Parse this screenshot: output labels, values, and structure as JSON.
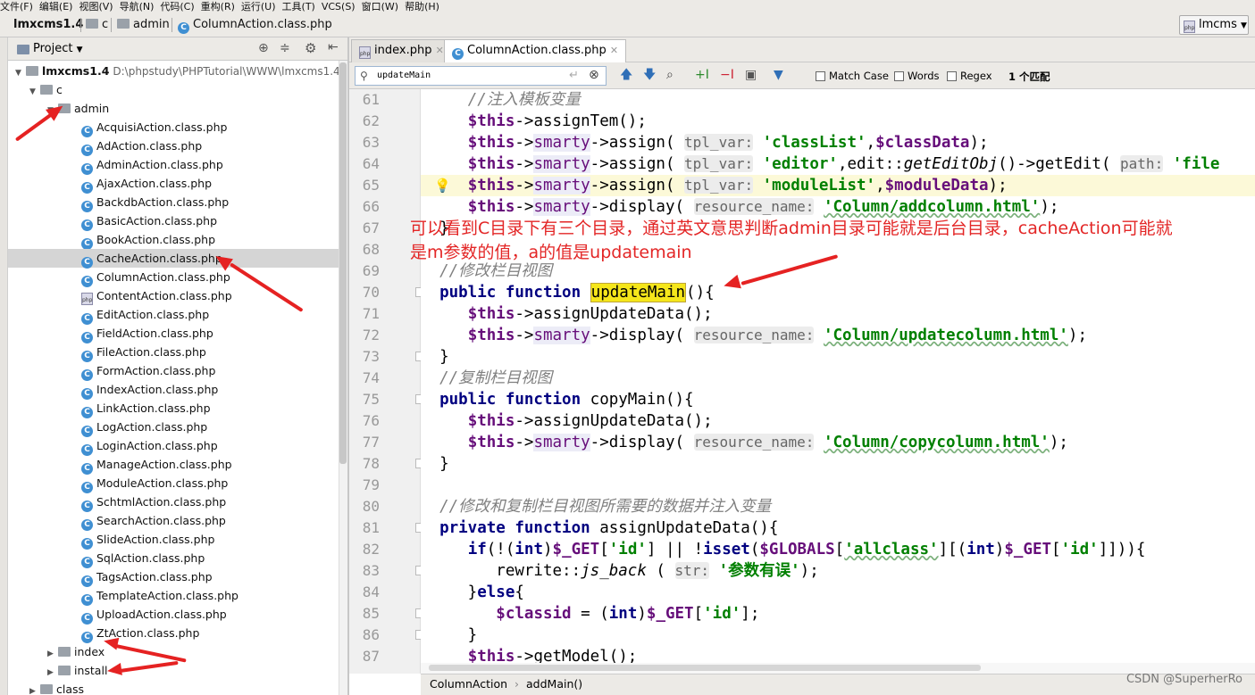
{
  "menu": [
    "文件(F)",
    "编辑(E)",
    "视图(V)",
    "导航(N)",
    "代码(C)",
    "重构(R)",
    "运行(U)",
    "工具(T)",
    "VCS(S)",
    "窗口(W)",
    "帮助(H)"
  ],
  "breadcrumb": {
    "project": "lmxcms1.4",
    "folder1": "c",
    "folder2": "admin",
    "file": "ColumnAction.class.php"
  },
  "run_config": "lmcms",
  "project_panel": {
    "title": "Project",
    "root_name": "lmxcms1.4",
    "root_path": "D:\\phpstudy\\PHPTutorial\\WWW\\lmxcms1.4",
    "c_folder": "c",
    "admin_folder": "admin",
    "files": [
      "AcquisiAction.class.php",
      "AdAction.class.php",
      "AdminAction.class.php",
      "AjaxAction.class.php",
      "BackdbAction.class.php",
      "BasicAction.class.php",
      "BookAction.class.php",
      "CacheAction.class.php",
      "ColumnAction.class.php",
      "ContentAction.class.php",
      "EditAction.class.php",
      "FieldAction.class.php",
      "FileAction.class.php",
      "FormAction.class.php",
      "IndexAction.class.php",
      "LinkAction.class.php",
      "LogAction.class.php",
      "LoginAction.class.php",
      "ManageAction.class.php",
      "ModuleAction.class.php",
      "SchtmlAction.class.php",
      "SearchAction.class.php",
      "SlideAction.class.php",
      "SqlAction.class.php",
      "TagsAction.class.php",
      "TemplateAction.class.php",
      "UploadAction.class.php",
      "ZtAction.class.php"
    ],
    "selected_file": "CacheAction.class.php",
    "after": [
      "index",
      "install",
      "class"
    ]
  },
  "tabs": [
    "index.php",
    "ColumnAction.class.php"
  ],
  "find": {
    "query": "updateMain",
    "match_case": "Match Case",
    "words": "Words",
    "regex": "Regex",
    "result": "1 个匹配"
  },
  "line_numbers": [
    "61",
    "62",
    "63",
    "64",
    "65",
    "66",
    "67",
    "68",
    "69",
    "70",
    "71",
    "72",
    "73",
    "74",
    "75",
    "76",
    "77",
    "78",
    "79",
    "80",
    "81",
    "82",
    "83",
    "84",
    "85",
    "86",
    "87"
  ],
  "code": {
    "l61": "//注入模板变量",
    "l69": "//修改栏目视图",
    "l74": "//复制栏目视图",
    "l80": "//修改和复制栏目视图所需要的数据并注入变量",
    "match": "updateMain",
    "str_classList": "'classList'",
    "str_editor": "'editor'",
    "str_moduleList": "'moduleList'",
    "str_addcolumn": "'Column/addcolumn.html'",
    "str_updatecolumn": "'Column/updatecolumn.html'",
    "str_copycolumn": "'Column/copycolumn.html'",
    "str_err": "'参数有误'"
  },
  "annotation": {
    "line1": "可以看到C目录下有三个目录，通过英文意思判断admin目录可能就是后台目录，cacheAction可能就",
    "line2": "是m参数的值，a的值是updatemain"
  },
  "status": {
    "class": "ColumnAction",
    "method": "addMain()"
  },
  "watermark": "CSDN @SuperherRo",
  "colors": {
    "annotation": "#e32626",
    "match_highlight": "#f5e61b",
    "keyword": "#000080",
    "string": "#008000",
    "field": "#660e7a"
  }
}
